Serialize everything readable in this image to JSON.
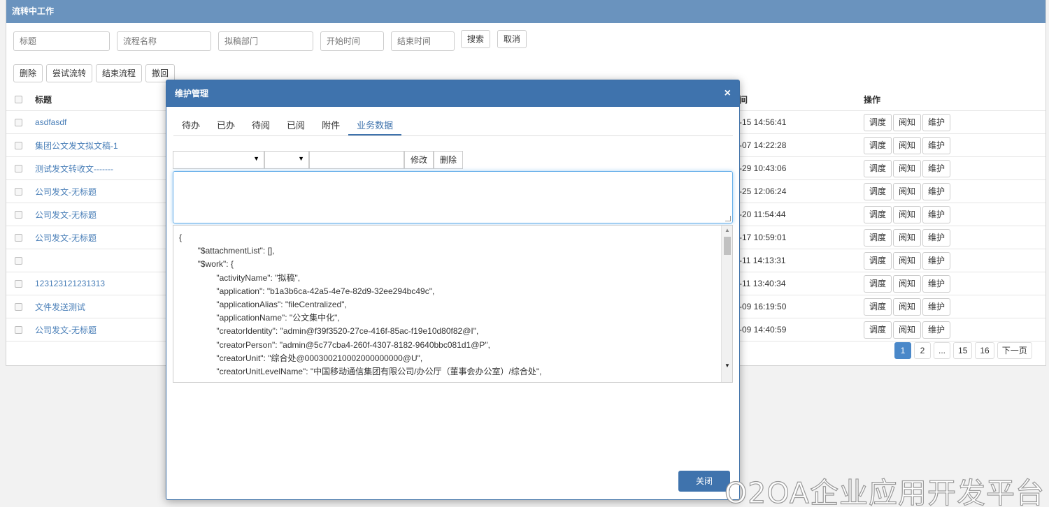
{
  "panel": {
    "title": "流转中工作"
  },
  "search": {
    "title_ph": "标题",
    "process_ph": "流程名称",
    "dept_ph": "拟稿部门",
    "start_ph": "开始时间",
    "end_ph": "结束时间",
    "search_label": "搜索",
    "cancel_label": "取消"
  },
  "actions": {
    "delete": "删除",
    "try_flow": "尝试流转",
    "end_flow": "结束流程",
    "revoke": "撤回"
  },
  "table": {
    "head_title": "标题",
    "head_time": "间",
    "head_ops": "操作",
    "op_dispatch": "调度",
    "op_read": "阅知",
    "op_maintain": "维护",
    "rows": [
      {
        "title": "asdfasdf",
        "time": "-15 14:56:41"
      },
      {
        "title": "集团公文发文拟文稿-1",
        "time": "-07 14:22:28"
      },
      {
        "title": "测试发文转收文-------",
        "time": "-29 10:43:06"
      },
      {
        "title": "公司发文-无标题",
        "time": "-25 12:06:24"
      },
      {
        "title": "公司发文-无标题",
        "time": "-20 11:54:44"
      },
      {
        "title": "公司发文-无标题",
        "time": "-17 10:59:01"
      },
      {
        "title": "",
        "time": "-11 14:13:31"
      },
      {
        "title": "123123121231313",
        "time": "-11 13:40:34"
      },
      {
        "title": "文件发送测试",
        "time": "-09 16:19:50"
      },
      {
        "title": "公司发文-无标题",
        "time": "-09 14:40:59"
      }
    ]
  },
  "pager": {
    "p1": "1",
    "p2": "2",
    "ellipsis": "...",
    "p15": "15",
    "p16": "16",
    "next": "下一页"
  },
  "modal": {
    "title": "维护管理",
    "close_x": "×",
    "tabs": [
      "待办",
      "已办",
      "待阅",
      "已阅",
      "附件",
      "业务数据"
    ],
    "modify": "修改",
    "delete": "删除",
    "close": "关闭",
    "json_lines": [
      "{",
      "        \"$attachmentList\": [],",
      "        \"$work\": {",
      "                \"activityName\": \"拟稿\",",
      "                \"application\": \"b1a3b6ca-42a5-4e7e-82d9-32ee294bc49c\",",
      "                \"applicationAlias\": \"fileCentralized\",",
      "                \"applicationName\": \"公文集中化\",",
      "                \"creatorIdentity\": \"admin@f39f3520-27ce-416f-85ac-f19e10d80f82@I\",",
      "                \"creatorPerson\": \"admin@5c77cba4-260f-4307-8182-9640bbc081d1@P\",",
      "                \"creatorUnit\": \"综合处@000300210002000000000@U\",",
      "                \"creatorUnitLevelName\": \"中国移动通信集团有限公司/办公厅（董事会办公室）/综合处\","
    ]
  },
  "watermark": "O2OA企业应用开发平台"
}
